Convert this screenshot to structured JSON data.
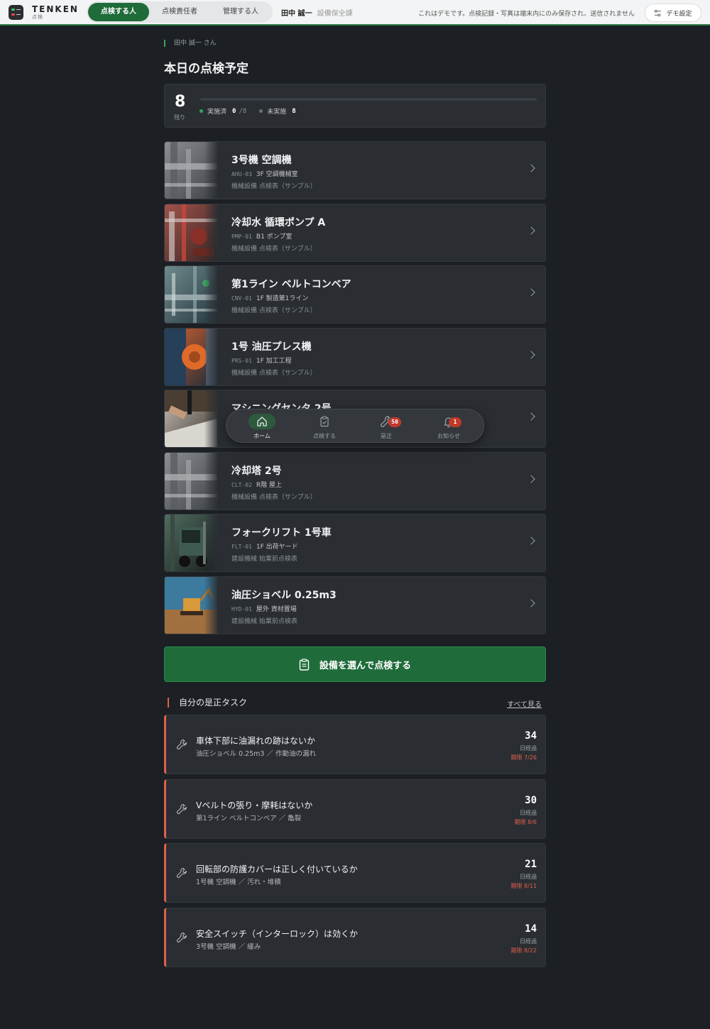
{
  "header": {
    "logo_title": "TENKEN",
    "logo_sub": "点検",
    "tabs": [
      "点検する人",
      "点検責任者",
      "管理する人"
    ],
    "user_name": "田中 誠一",
    "user_dept": "設備保全課",
    "demo_note": "これはデモです。点検記録・写真は端末内にのみ保存され、送信されません",
    "demo_button": "デモ設定"
  },
  "greeting": "田中 誠一 さん",
  "title": "本日の点検予定",
  "summary": {
    "remaining": "8",
    "remaining_label": "残り",
    "done_label": "実施済",
    "done_count": "0",
    "done_total": "/8",
    "pending_label": "未実施",
    "pending_count": "8",
    "progress": 0,
    "done_color": "#3aa35f",
    "pending_color": "#6b7178"
  },
  "equipment": [
    {
      "name": "3号機 空調機",
      "code": "AHU-03",
      "location": "3F 空調機械室",
      "form": "機械設備 点検表（サンプル）",
      "thumb": "pipes"
    },
    {
      "name": "冷却水 循環ポンプ A",
      "code": "PMP-01",
      "location": "B1 ポンプ室",
      "form": "機械設備 点検表（サンプル）",
      "thumb": "pump"
    },
    {
      "name": "第1ライン ベルトコンベア",
      "code": "CNV-01",
      "location": "1F 製造第1ライン",
      "form": "機械設備 点検表（サンプル）",
      "thumb": "conveyor"
    },
    {
      "name": "1号 油圧プレス機",
      "code": "PRS-01",
      "location": "1F 加工工程",
      "form": "機械設備 点検表（サンプル）",
      "thumb": "press"
    },
    {
      "name": "マシニングセンタ 2号",
      "code": "",
      "location": "",
      "form": "",
      "thumb": "machining"
    },
    {
      "name": "冷却塔 2号",
      "code": "CLT-02",
      "location": "R階 屋上",
      "form": "機械設備 点検表（サンプル）",
      "thumb": "pipes"
    },
    {
      "name": "フォークリフト 1号車",
      "code": "FLT-01",
      "location": "1F 出荷ヤード",
      "form": "建設機械 始業前点検表",
      "thumb": "forklift"
    },
    {
      "name": "油圧ショベル 0.25m3",
      "code": "HYD-01",
      "location": "屋外 資材置場",
      "form": "建設機械 始業前点検表",
      "thumb": "excavator"
    }
  ],
  "cta_label": "設備を選んで点検する",
  "tasks": {
    "title": "自分の是正タスク",
    "see_all": "すべて見る",
    "days_label": "日経過",
    "items": [
      {
        "title": "車体下部に油漏れの跡はないか",
        "sub": "油圧ショベル 0.25m3 ／ 作動油の漏れ",
        "days": "34",
        "due": "期限 7/26"
      },
      {
        "title": "Vベルトの張り・摩耗はないか",
        "sub": "第1ライン ベルトコンベア ／ 亀裂",
        "days": "30",
        "due": "期限 8/6"
      },
      {
        "title": "回転部の防護カバーは正しく付いているか",
        "sub": "1号機 空調機 ／ 汚れ・堆積",
        "days": "21",
        "due": "期限 8/11"
      },
      {
        "title": "安全スイッチ（インターロック）は効くか",
        "sub": "3号機 空調機 ／ 緩み",
        "days": "14",
        "due": "期限 8/22"
      }
    ]
  },
  "nav": [
    {
      "label": "ホーム",
      "icon": "home-icon"
    },
    {
      "label": "点検する",
      "icon": "clipboard-icon"
    },
    {
      "label": "是正",
      "icon": "wrench-icon",
      "badge": "50"
    },
    {
      "label": "お知らせ",
      "icon": "bell-icon",
      "badge": "1"
    }
  ]
}
